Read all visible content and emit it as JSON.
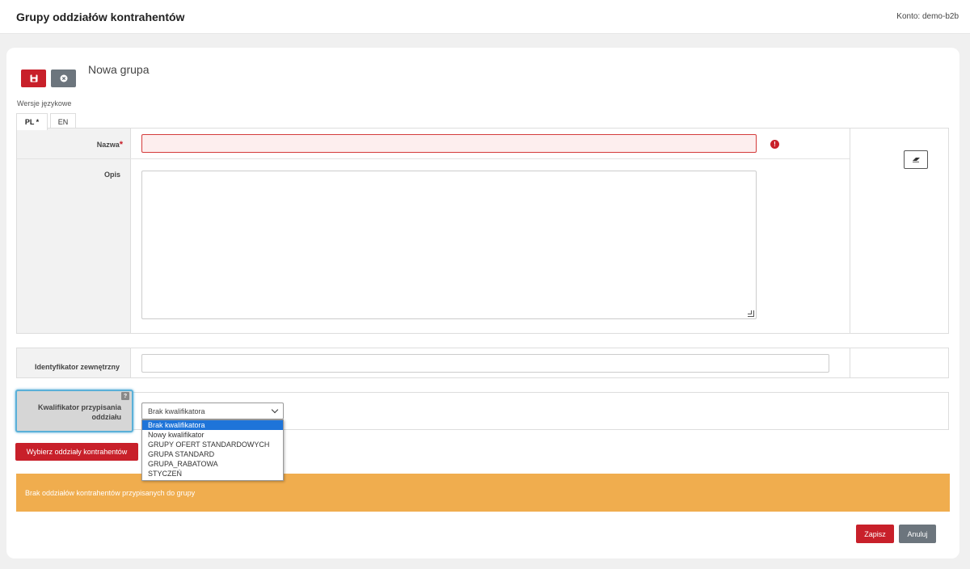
{
  "header": {
    "title": "Grupy oddziałów kontrahentów",
    "account": "Konto: demo-b2b"
  },
  "toolbar": {
    "save_icon": "floppy-disk-icon",
    "close_icon": "close-circle-icon"
  },
  "form": {
    "title": "Nowa grupa",
    "lang_versions_label": "Wersje językowe",
    "tabs": [
      {
        "label": "PL *",
        "active": true
      },
      {
        "label": "EN",
        "active": false
      }
    ],
    "fields": {
      "nazwa_label": "Nazwa",
      "nazwa_required_mark": "*",
      "nazwa_value": "",
      "opis_label": "Opis",
      "opis_value": "",
      "ident_label": "Identyfikator zewnętrzny",
      "ident_value": "",
      "kwal_label": "Kwalifikator przypisania oddziału",
      "kwal_help": "?",
      "kwal_selected": "Brak kwalifikatora",
      "kwal_options": [
        "Brak kwalifikatora",
        "Nowy kwalifikator",
        "GRUPY OFERT STANDARDOWYCH",
        "GRUPA STANDARD",
        "GRUPA_RABATOWA",
        "STYCZEŃ"
      ]
    },
    "error_icon_text": "!",
    "choose_button": "Wybierz oddziały kontrahentów",
    "alert_text": "Brak oddziałów kontrahentów przypisanych do grupy",
    "save_button": "Zapisz",
    "cancel_button": "Anuluj"
  },
  "colors": {
    "primary_red": "#c8202a",
    "secondary_gray": "#6c757d",
    "warning_orange": "#f0ad4e",
    "selection_blue": "#1e74d9",
    "focus_blue": "#5ab0d8"
  }
}
